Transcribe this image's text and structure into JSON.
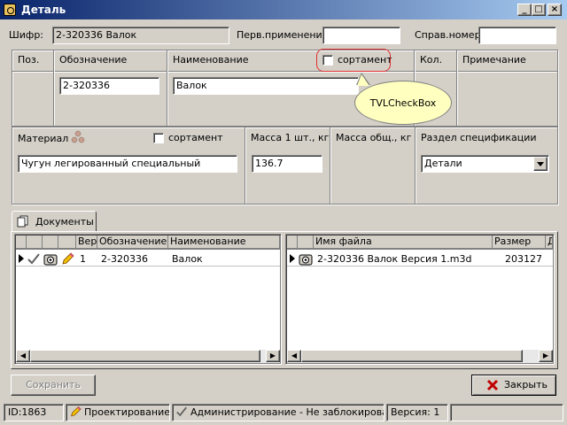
{
  "window": {
    "title": "Деталь",
    "minimize": "_",
    "maximize": "□",
    "close": "×"
  },
  "header": {
    "cipher_label": "Шифр:",
    "cipher_value": "2-320336 Валок",
    "first_use_label": "Перв.применение:",
    "first_use_value": "",
    "ref_number_label": "Справ.номер:",
    "ref_number_value": ""
  },
  "spec_row": {
    "pos_header": "Поз.",
    "designation_header": "Обозначение",
    "designation_value": "2-320336",
    "name_header": "Наименование",
    "name_value": "Валок",
    "sortament_label": "сортамент",
    "sortament_checked": false,
    "qty_header": "Кол.",
    "note_header": "Примечание"
  },
  "callout": {
    "text": "TVLCheckBox"
  },
  "material_row": {
    "material_label": "Материал",
    "material_sortament_label": "сортамент",
    "material_value": "Чугун легированный специальный",
    "mass_unit_header": "Масса 1 шт., кг",
    "mass_unit_value": "136.7",
    "mass_total_header": "Масса общ., кг",
    "section_header": "Раздел спецификации",
    "section_value": "Детали"
  },
  "tabs": [
    {
      "label": "Документы"
    }
  ],
  "docs_grid": {
    "columns": [
      "",
      "",
      "",
      "",
      "Вер.",
      "Обозначение",
      "Наименование"
    ],
    "rows": [
      {
        "version": "1",
        "designation": "2-320336",
        "name": "Валок"
      }
    ]
  },
  "files_grid": {
    "columns": [
      "",
      "",
      "Имя файла",
      "Размер",
      "Д"
    ],
    "rows": [
      {
        "filename": "2-320336 Валок Версия 1.m3d",
        "size": "203127"
      }
    ]
  },
  "buttons": {
    "save": "Сохранить",
    "close": "Закрыть"
  },
  "status": {
    "id": "ID:1863",
    "mode": "Проектирование",
    "admin": "Администрирование - Не заблокирован",
    "version": "Версия: 1"
  },
  "colors": {
    "titlebar": "#0a246a",
    "callout": "#ffffc0",
    "highlight": "#e03030",
    "close_x": "#c00000"
  }
}
